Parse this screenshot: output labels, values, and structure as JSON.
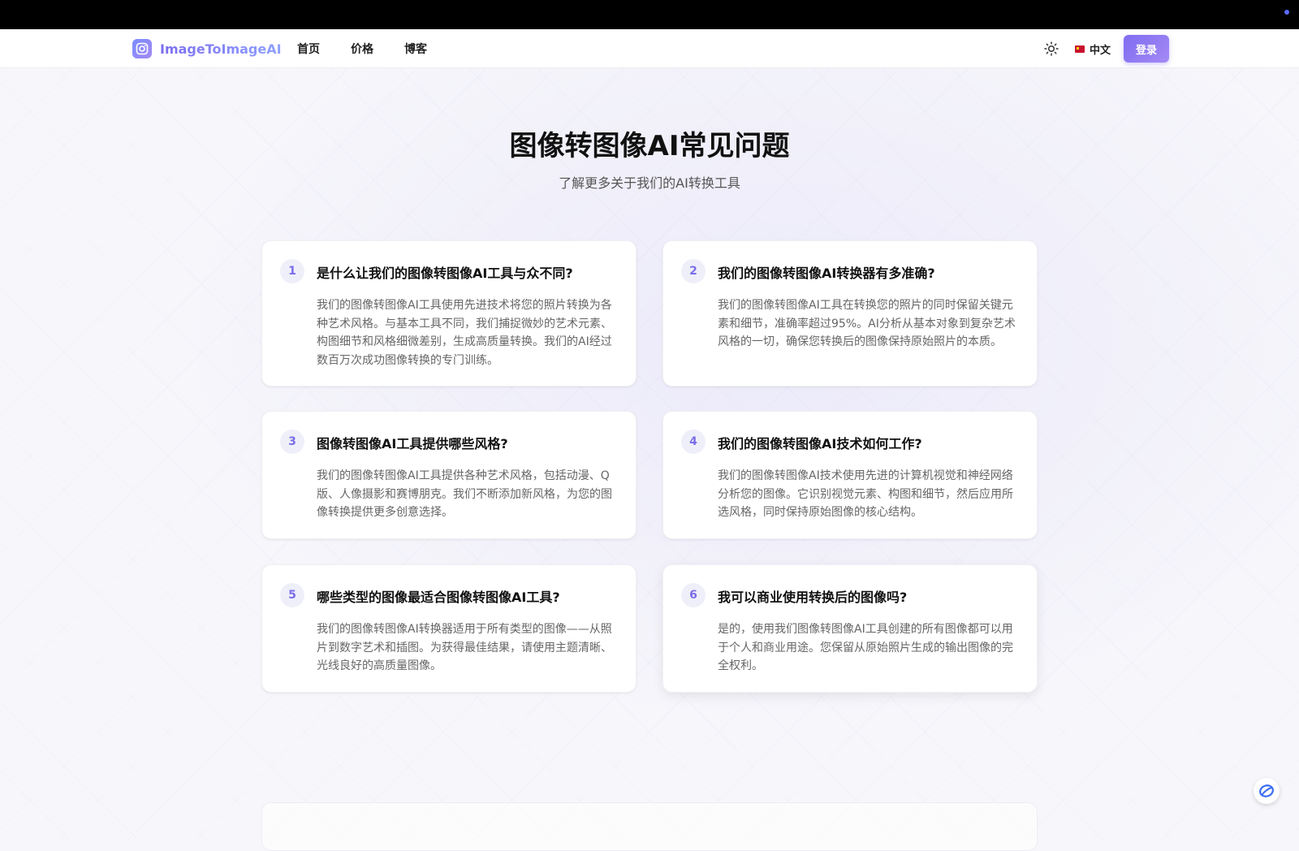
{
  "nav": {
    "brand": "ImageToImageAI",
    "links": [
      "首页",
      "价格",
      "博客"
    ],
    "language": "中文",
    "login_label": "登录"
  },
  "faq": {
    "title": "图像转图像AI常见问题",
    "subtitle": "了解更多关于我们的AI转换工具",
    "items": [
      {
        "num": "1",
        "question": "是什么让我们的图像转图像AI工具与众不同?",
        "answer": "我们的图像转图像AI工具使用先进技术将您的照片转换为各种艺术风格。与基本工具不同，我们捕捉微妙的艺术元素、构图细节和风格细微差别，生成高质量转换。我们的AI经过数百万次成功图像转换的专门训练。"
      },
      {
        "num": "2",
        "question": "我们的图像转图像AI转换器有多准确?",
        "answer": "我们的图像转图像AI工具在转换您的照片的同时保留关键元素和细节，准确率超过95%。AI分析从基本对象到复杂艺术风格的一切，确保您转换后的图像保持原始照片的本质。"
      },
      {
        "num": "3",
        "question": "图像转图像AI工具提供哪些风格?",
        "answer": "我们的图像转图像AI工具提供各种艺术风格，包括动漫、Q版、人像摄影和赛博朋克。我们不断添加新风格，为您的图像转换提供更多创意选择。"
      },
      {
        "num": "4",
        "question": "我们的图像转图像AI技术如何工作?",
        "answer": "我们的图像转图像AI技术使用先进的计算机视觉和神经网络分析您的图像。它识别视觉元素、构图和细节，然后应用所选风格，同时保持原始图像的核心结构。"
      },
      {
        "num": "5",
        "question": "哪些类型的图像最适合图像转图像AI工具?",
        "answer": "我们的图像转图像AI转换器适用于所有类型的图像——从照片到数字艺术和插图。为获得最佳结果，请使用主题清晰、光线良好的高质量图像。"
      },
      {
        "num": "6",
        "question": "我可以商业使用转换后的图像吗?",
        "answer": "是的，使用我们图像转图像AI工具创建的所有图像都可以用于个人和商业用途。您保留从原始照片生成的输出图像的完全权利。"
      }
    ]
  },
  "colors": {
    "accent": "#7f6cf0",
    "number_bg": "#efeffa",
    "number_fg": "#7a6de8"
  }
}
